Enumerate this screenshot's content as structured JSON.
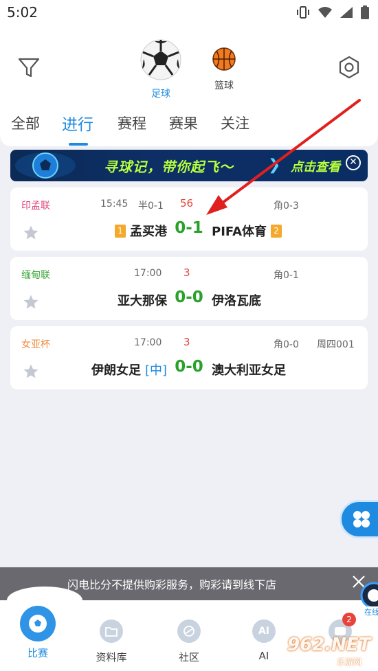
{
  "status_bar": {
    "time": "5:02"
  },
  "header": {
    "sports": [
      {
        "label": "足球",
        "active": true,
        "icon": "soccer-ball-icon"
      },
      {
        "label": "篮球",
        "active": false,
        "icon": "basketball-icon"
      }
    ],
    "tabs": [
      "全部",
      "进行",
      "赛程",
      "赛果",
      "关注"
    ],
    "active_tab": "进行"
  },
  "banner": {
    "headline": "寻球记，带你起飞～",
    "cta": "点击查看"
  },
  "matches": [
    {
      "league": "印孟联",
      "league_color": "#e0457b",
      "kickoff": "15:45",
      "halftime": "半0-1",
      "minute": "56",
      "corner": "角0-3",
      "match_no": "",
      "home": "孟买港",
      "home_rank": "1",
      "away": "PIFA体育",
      "away_rank": "2",
      "score": "0-1",
      "neutral": ""
    },
    {
      "league": "缅甸联",
      "league_color": "#3aa63a",
      "kickoff": "17:00",
      "halftime": "",
      "minute": "3",
      "corner": "角0-1",
      "match_no": "",
      "home": "亚大那保",
      "home_rank": "",
      "away": "伊洛瓦底",
      "away_rank": "",
      "score": "0-0",
      "neutral": ""
    },
    {
      "league": "女亚杯",
      "league_color": "#f08a3c",
      "kickoff": "17:00",
      "halftime": "",
      "minute": "3",
      "corner": "角0-0",
      "match_no": "周四001",
      "home": "伊朗女足",
      "home_rank": "",
      "away": "澳大利亚女足",
      "away_rank": "",
      "score": "0-0",
      "neutral": "[中]"
    }
  ],
  "notice": {
    "text": "闪电比分不提供购彩服务，购彩请到线下店"
  },
  "bottom_nav": {
    "items": [
      {
        "label": "比赛",
        "active": true
      },
      {
        "label": "资料库",
        "active": false
      },
      {
        "label": "社区",
        "active": false
      },
      {
        "label": "AI",
        "active": false,
        "icon_text": "AI"
      },
      {
        "label": "",
        "active": false
      }
    ],
    "badge_count": "2",
    "kefu_label": "在线"
  },
  "watermark": {
    "brand": "962.NET",
    "sub": "乐游网"
  },
  "colors": {
    "accent": "#1f8be0",
    "score_green": "#2aa12a",
    "minute_red": "#e0453a"
  }
}
